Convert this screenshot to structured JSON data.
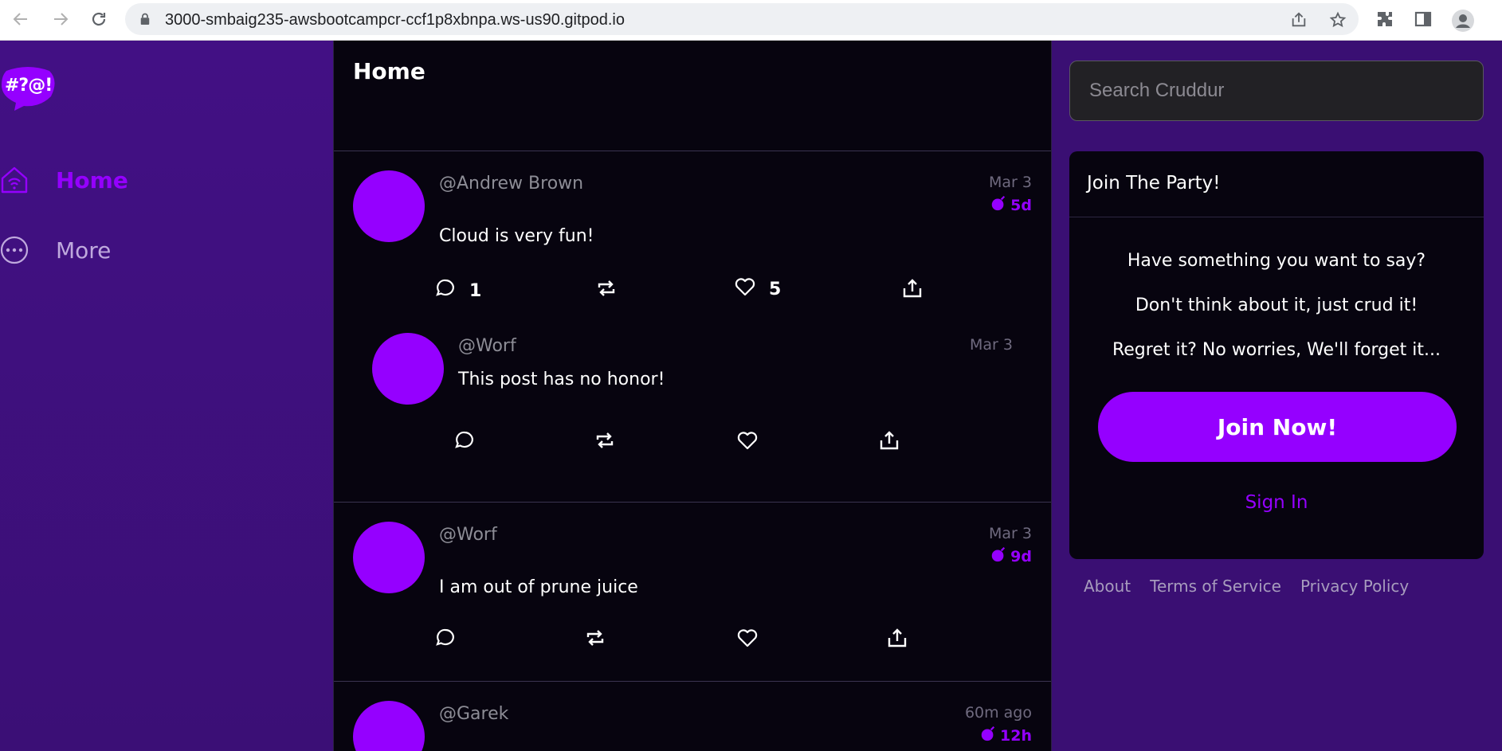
{
  "browser": {
    "url": "3000-smbaig235-awsbootcampcr-ccf1p8xbnpa.ws-us90.gitpod.io"
  },
  "sidebar": {
    "logo_text": "#?@!",
    "items": [
      {
        "label": "Home",
        "icon": "home-icon",
        "active": true
      },
      {
        "label": "More",
        "icon": "more-icon",
        "active": false
      }
    ]
  },
  "feed": {
    "title": "Home",
    "posts": [
      {
        "handle": "@Andrew Brown",
        "message": "Cloud is very fun!",
        "date": "Mar 3",
        "expires": "5d",
        "replies_count": "1",
        "likes_count": "5",
        "reply": {
          "handle": "@Worf",
          "message": "This post has no honor!",
          "date": "Mar 3"
        }
      },
      {
        "handle": "@Worf",
        "message": "I am out of prune juice",
        "date": "Mar 3",
        "expires": "9d"
      },
      {
        "handle": "@Garek",
        "date": "60m ago",
        "expires": "12h"
      }
    ]
  },
  "search": {
    "placeholder": "Search Cruddur"
  },
  "join_box": {
    "title": "Join The Party!",
    "lines": [
      "Have something you want to say?",
      "Don't think about it, just crud it!",
      "Regret it? No worries, We'll forget it..."
    ],
    "join_label": "Join Now!",
    "signin_label": "Sign In"
  },
  "footer": {
    "links": [
      "About",
      "Terms of Service",
      "Privacy Policy"
    ]
  },
  "colors": {
    "accent": "#9500ff",
    "sidebar_bg": "#421084",
    "feed_bg": "#07040f"
  }
}
